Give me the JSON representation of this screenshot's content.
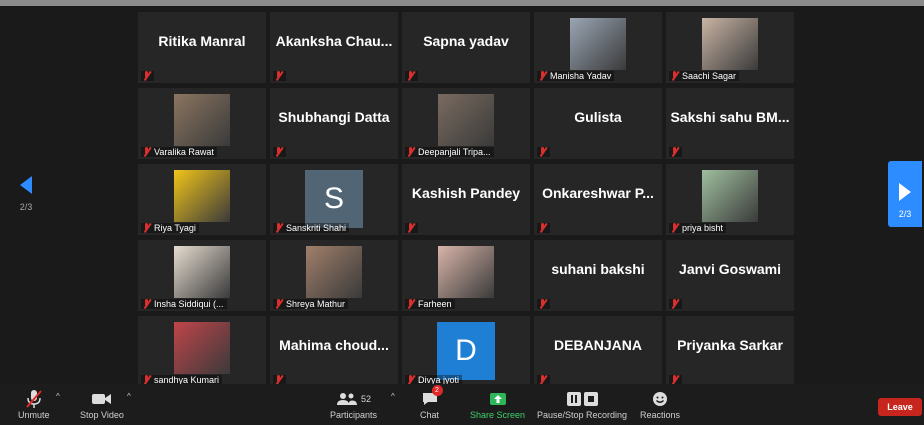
{
  "pager": {
    "left": "2/3",
    "right": "2/3"
  },
  "tiles": [
    {
      "name": "Ritika Manral",
      "kind": "name"
    },
    {
      "name": "Akanksha  Chau...",
      "kind": "name"
    },
    {
      "name": "Sapna yadav",
      "kind": "name"
    },
    {
      "name": "Manisha Yadav",
      "kind": "photo",
      "photo": "mountain-photo",
      "color": "#9aa6b4"
    },
    {
      "name": "Saachi Sagar",
      "kind": "photo",
      "photo": "portrait-photo",
      "color": "#c9b4a4"
    },
    {
      "name": "Varalika Rawat",
      "kind": "photo",
      "photo": "portrait-photo",
      "color": "#8b7560"
    },
    {
      "name": "Shubhangi Datta",
      "kind": "name"
    },
    {
      "name": "Deepanjali Tripa...",
      "kind": "photo",
      "photo": "portrait-photo",
      "color": "#7a6b60"
    },
    {
      "name": "Gulista",
      "kind": "name"
    },
    {
      "name": "Sakshi sahu BM...",
      "kind": "name"
    },
    {
      "name": "Riya Tyagi",
      "kind": "photo",
      "photo": "yellow-graphic",
      "color": "#f0c419"
    },
    {
      "name": "Sanskriti Shahi",
      "kind": "letter",
      "letter": "S",
      "color": "#516574"
    },
    {
      "name": "Kashish Pandey",
      "kind": "name"
    },
    {
      "name": "Onkareshwar  P...",
      "kind": "name"
    },
    {
      "name": "priya bisht",
      "kind": "photo",
      "photo": "portrait-photo",
      "color": "#9fbf9f"
    },
    {
      "name": "Insha Siddiqui (...",
      "kind": "photo",
      "photo": "quote-card",
      "color": "#e6ddd0"
    },
    {
      "name": "Shreya Mathur",
      "kind": "photo",
      "photo": "portrait-photo",
      "color": "#a07f6a"
    },
    {
      "name": "Farheen",
      "kind": "photo",
      "photo": "portrait-photo",
      "color": "#d8b4a8"
    },
    {
      "name": "suhani bakshi",
      "kind": "name"
    },
    {
      "name": "Janvi Goswami",
      "kind": "name"
    },
    {
      "name": "sandhya Kumari",
      "kind": "photo",
      "photo": "red-graphic",
      "color": "#c0454a"
    },
    {
      "name": "Mahima  choud...",
      "kind": "name"
    },
    {
      "name": "Divya jyoti",
      "kind": "letter",
      "letter": "D",
      "color": "#1f7fd4"
    },
    {
      "name": "DEBANJANA",
      "kind": "name"
    },
    {
      "name": "Priyanka Sarkar",
      "kind": "name"
    }
  ],
  "toolbar": {
    "unmute": "Unmute",
    "stop_video": "Stop Video",
    "participants": "Participants",
    "participants_count": "52",
    "chat": "Chat",
    "chat_badge": "2",
    "share_screen": "Share Screen",
    "record": "Pause/Stop Recording",
    "reactions": "Reactions",
    "leave": "Leave"
  }
}
